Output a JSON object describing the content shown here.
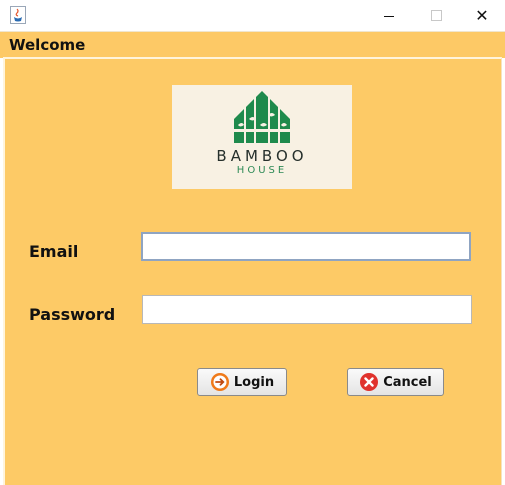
{
  "window": {
    "title_bar_icon": "java-cup-icon",
    "controls": {
      "minimize": "minimize-icon",
      "maximize": "maximize-icon",
      "close": "close-icon",
      "close_glyph": "✕"
    }
  },
  "frame": {
    "title": "Welcome"
  },
  "logo": {
    "name": "BAMBOO",
    "subtitle": "HOUSE"
  },
  "form": {
    "email_label": "Email",
    "email_value": "",
    "password_label": "Password",
    "password_value": ""
  },
  "buttons": {
    "login": {
      "label": "Login",
      "icon": "login-arrow-icon"
    },
    "cancel": {
      "label": "Cancel",
      "icon": "cancel-x-icon"
    }
  },
  "colors": {
    "background": "#fdca66",
    "logo_green": "#1f8a4c",
    "cancel_red": "#e0322d",
    "login_orange": "#f07a1a"
  }
}
